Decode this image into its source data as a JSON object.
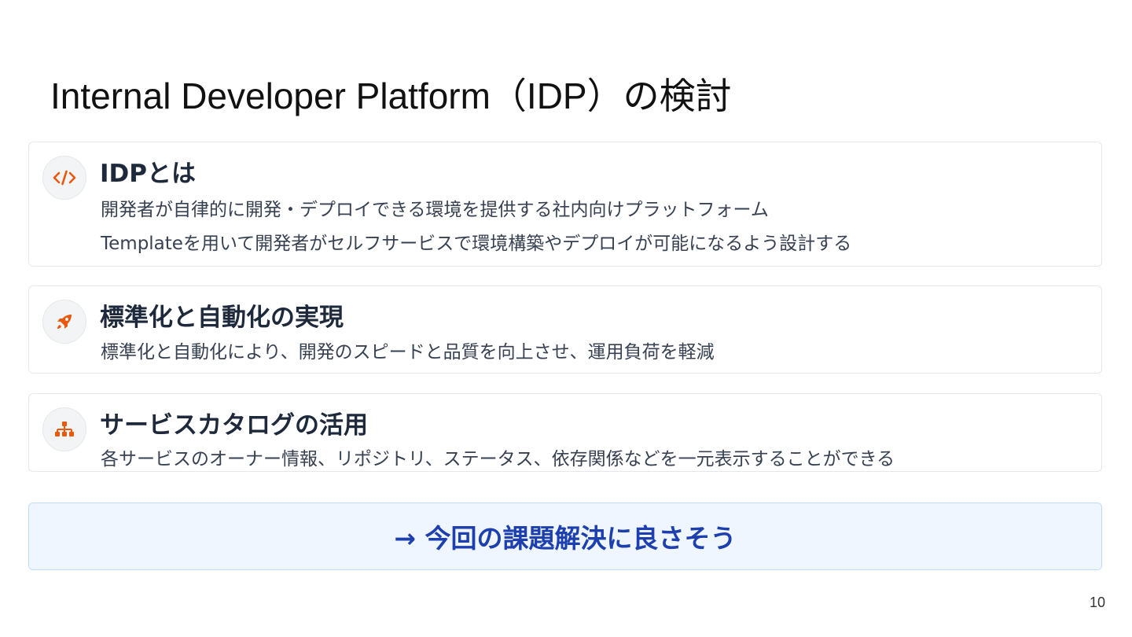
{
  "slide": {
    "title": "Internal Developer Platform（IDP）の検討",
    "page_number": "10"
  },
  "cards": [
    {
      "icon": "code-icon",
      "heading": "IDPとは",
      "lines": [
        "開発者が自律的に開発・デプロイできる環境を提供する社内向けプラットフォーム",
        "Templateを用いて開発者がセルフサービスで環境構築やデプロイが可能になるよう設計する"
      ]
    },
    {
      "icon": "rocket-icon",
      "heading": "標準化と自動化の実現",
      "lines": [
        "標準化と自動化により、開発のスピードと品質を向上させ、運用負荷を軽減"
      ]
    },
    {
      "icon": "sitemap-icon",
      "heading": "サービスカタログの活用",
      "lines": [
        "各サービスのオーナー情報、リポジトリ、ステータス、依存関係などを一元表示することができる"
      ]
    }
  ],
  "conclusion": {
    "text": "→ 今回の課題解決に良さそう"
  },
  "colors": {
    "icon_accent": "#ea580c",
    "conclusion_text": "#1e40af",
    "conclusion_bg": "#eff6ff",
    "heading": "#1e293b"
  }
}
